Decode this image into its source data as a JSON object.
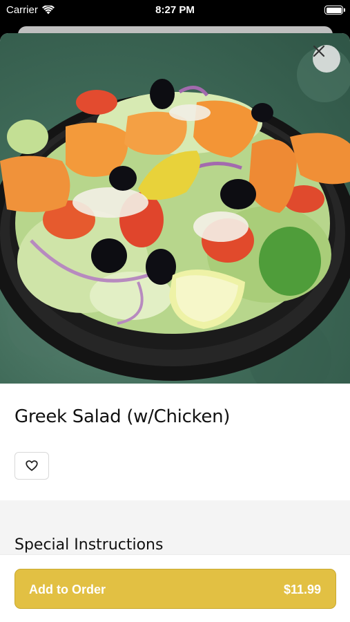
{
  "status_bar": {
    "carrier": "Carrier",
    "time": "8:27 PM"
  },
  "product": {
    "name": "Greek Salad (w/Chicken)",
    "image_alt": "greek-salad-photo"
  },
  "special_instructions": {
    "label": "Special Instructions"
  },
  "order_button": {
    "label": "Add to Order",
    "price": "$11.99"
  },
  "icons": {
    "close": "close-icon",
    "favorite": "heart-icon",
    "wifi": "wifi-icon",
    "battery": "battery-icon"
  },
  "colors": {
    "accent": "#e2c043",
    "background": "#ffffff",
    "section_bg": "#f4f4f4"
  }
}
